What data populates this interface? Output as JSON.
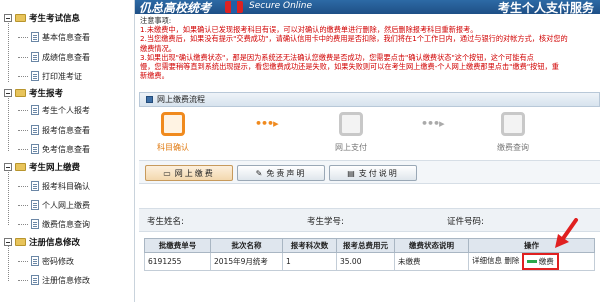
{
  "sidebar": {
    "groups": [
      {
        "label": "考生考试信息",
        "items": [
          "基本信息查看",
          "成绩信息查看",
          "打印准考证"
        ]
      },
      {
        "label": "考生报考",
        "items": [
          "考生个人报考",
          "报考信息查看",
          "免考信息查看"
        ]
      },
      {
        "label": "考生网上缴费",
        "items": [
          "报考科目确认",
          "个人网上缴费",
          "缴费信息查询"
        ]
      },
      {
        "label": "注册信息修改",
        "items": [
          "密码修改",
          "注册信息修改"
        ]
      }
    ]
  },
  "banner": {
    "title": "仉总高校统考",
    "secure": "Secure Online",
    "right": "考生个人支付服务"
  },
  "notice": {
    "title": "注意事项:",
    "lines": [
      "1.未缴费中，如果确认已发现报考科目有误，可以对确认的缴费单进行删除，然后删除报考科目重新报考。",
      "2.当您缴费后，如果没有提示\"交费成功\"，请确认信用卡中的费用是否扣除，我们将在1个工作日内，通过与银行的对帐方式，核对您的",
      "  缴费情况。",
      "3.如果出现\"确认缴费状态\"，那是因为系统还无法确认您缴费是否成功，您需要点击\"确认缴费状态\"这个按钮，这个可能有点",
      "  慢，您需要稍等直到系统出现提示，看您缴费成功还是失败，如果失败则可以在考生网上缴费-个人网上缴费那里点击\"缴费\"按钮，重",
      "  新缴费。"
    ]
  },
  "section": {
    "title": "网上缴费流程"
  },
  "steps": [
    {
      "label": "科目确认",
      "active": true
    },
    {
      "label": "网上支付",
      "active": false
    },
    {
      "label": "缴费查询",
      "active": false
    }
  ],
  "buttons": {
    "pay": "网上缴费",
    "disclaimer": "免责声明",
    "instructions": "支付说明"
  },
  "info": {
    "name_label": "考生姓名:",
    "id_label": "考生学号:",
    "cert_label": "证件号码:"
  },
  "table": {
    "headers": [
      "批缴费单号",
      "批次名称",
      "报考科次数",
      "报考总费用元",
      "缴费状态说明",
      "操作"
    ],
    "rows": [
      {
        "order": "6191255",
        "batch": "2015年9月统考",
        "count": "1",
        "fee": "35.00",
        "status": "未缴费",
        "op_detail": "详细信息",
        "op_delete": "删除",
        "op_pay": "缴费"
      }
    ]
  },
  "colors": {
    "accent": "#f08a1e",
    "banner": "#1e4f86",
    "notice": "#d10000",
    "highlight": "#e02020"
  }
}
